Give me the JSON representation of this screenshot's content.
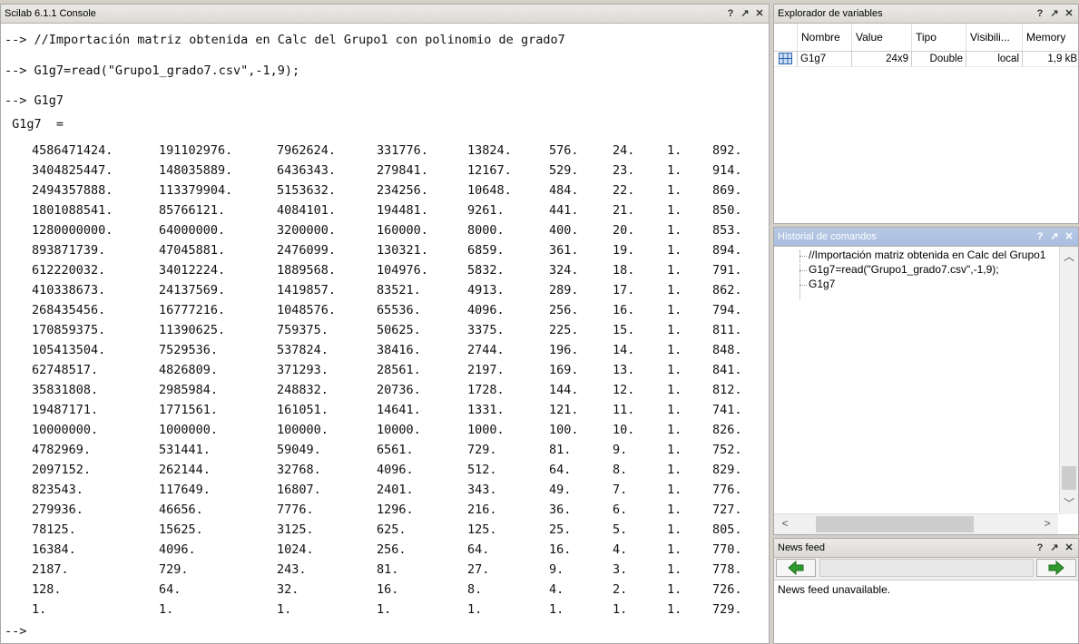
{
  "console": {
    "title": "Scilab 6.1.1 Console",
    "lines": [
      "--> //Importación matriz obtenida en Calc del Grupo1 con polinomio de grado7",
      "--> G1g7=read(\"Grupo1_grado7.csv\",-1,9);",
      "--> G1g7",
      " G1g7  ="
    ],
    "matrix": [
      [
        "4586471424.",
        "191102976.",
        "7962624.",
        "331776.",
        "13824.",
        "576.",
        "24.",
        "1.",
        "892."
      ],
      [
        "3404825447.",
        "148035889.",
        "6436343.",
        "279841.",
        "12167.",
        "529.",
        "23.",
        "1.",
        "914."
      ],
      [
        "2494357888.",
        "113379904.",
        "5153632.",
        "234256.",
        "10648.",
        "484.",
        "22.",
        "1.",
        "869."
      ],
      [
        "1801088541.",
        "85766121.",
        "4084101.",
        "194481.",
        "9261.",
        "441.",
        "21.",
        "1.",
        "850."
      ],
      [
        "1280000000.",
        "64000000.",
        "3200000.",
        "160000.",
        "8000.",
        "400.",
        "20.",
        "1.",
        "853."
      ],
      [
        "893871739.",
        "47045881.",
        "2476099.",
        "130321.",
        "6859.",
        "361.",
        "19.",
        "1.",
        "894."
      ],
      [
        "612220032.",
        "34012224.",
        "1889568.",
        "104976.",
        "5832.",
        "324.",
        "18.",
        "1.",
        "791."
      ],
      [
        "410338673.",
        "24137569.",
        "1419857.",
        "83521.",
        "4913.",
        "289.",
        "17.",
        "1.",
        "862."
      ],
      [
        "268435456.",
        "16777216.",
        "1048576.",
        "65536.",
        "4096.",
        "256.",
        "16.",
        "1.",
        "794."
      ],
      [
        "170859375.",
        "11390625.",
        "759375.",
        "50625.",
        "3375.",
        "225.",
        "15.",
        "1.",
        "811."
      ],
      [
        "105413504.",
        "7529536.",
        "537824.",
        "38416.",
        "2744.",
        "196.",
        "14.",
        "1.",
        "848."
      ],
      [
        "62748517.",
        "4826809.",
        "371293.",
        "28561.",
        "2197.",
        "169.",
        "13.",
        "1.",
        "841."
      ],
      [
        "35831808.",
        "2985984.",
        "248832.",
        "20736.",
        "1728.",
        "144.",
        "12.",
        "1.",
        "812."
      ],
      [
        "19487171.",
        "1771561.",
        "161051.",
        "14641.",
        "1331.",
        "121.",
        "11.",
        "1.",
        "741."
      ],
      [
        "10000000.",
        "1000000.",
        "100000.",
        "10000.",
        "1000.",
        "100.",
        "10.",
        "1.",
        "826."
      ],
      [
        "4782969.",
        "531441.",
        "59049.",
        "6561.",
        "729.",
        "81.",
        "9.",
        "1.",
        "752."
      ],
      [
        "2097152.",
        "262144.",
        "32768.",
        "4096.",
        "512.",
        "64.",
        "8.",
        "1.",
        "829."
      ],
      [
        "823543.",
        "117649.",
        "16807.",
        "2401.",
        "343.",
        "49.",
        "7.",
        "1.",
        "776."
      ],
      [
        "279936.",
        "46656.",
        "7776.",
        "1296.",
        "216.",
        "36.",
        "6.",
        "1.",
        "727."
      ],
      [
        "78125.",
        "15625.",
        "3125.",
        "625.",
        "125.",
        "25.",
        "5.",
        "1.",
        "805."
      ],
      [
        "16384.",
        "4096.",
        "1024.",
        "256.",
        "64.",
        "16.",
        "4.",
        "1.",
        "770."
      ],
      [
        "2187.",
        "729.",
        "243.",
        "81.",
        "27.",
        "9.",
        "3.",
        "1.",
        "778."
      ],
      [
        "128.",
        "64.",
        "32.",
        "16.",
        "8.",
        "4.",
        "2.",
        "1.",
        "726."
      ],
      [
        "1.",
        "1.",
        "1.",
        "1.",
        "1.",
        "1.",
        "1.",
        "1.",
        "729."
      ]
    ],
    "prompt": "-->"
  },
  "varexp": {
    "title": "Explorador de variables",
    "headers": [
      "Nombre",
      "Value",
      "Tipo",
      "Visibili...",
      "Memory"
    ],
    "row": {
      "name": "G1g7",
      "value": "24x9",
      "type": "Double",
      "visibility": "local",
      "memory": "1,9 kB"
    }
  },
  "history": {
    "title": "Historial de comandos",
    "items": [
      "//Importación matriz obtenida en Calc del Grupo1",
      "G1g7=read(\"Grupo1_grado7.csv\",-1,9);",
      "G1g7"
    ]
  },
  "news": {
    "title": "News feed",
    "message": "News feed unavailable.",
    "arrow_color": "#2e9a2e"
  },
  "titlebar_buttons": {
    "help": "?",
    "undock": "↗",
    "close": "✕"
  }
}
